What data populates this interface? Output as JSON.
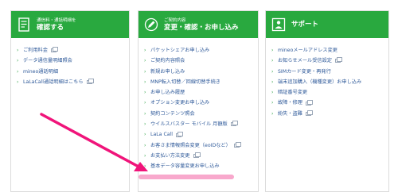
{
  "panels": [
    {
      "subtitle": "通信料・通話明細を",
      "title": "確認する",
      "icon": "bill-list-icon",
      "items": [
        {
          "label": "ご利用料金",
          "external": true
        },
        {
          "label": "データ通信量明細照会",
          "external": false
        },
        {
          "label": "mineo通話明細",
          "external": false
        },
        {
          "label": "LaLaCall通話明細はこちら",
          "external": true
        }
      ]
    },
    {
      "subtitle": "ご契約内容",
      "title": "変更・確認・お申し込み",
      "icon": "pencil-contract-icon",
      "items": [
        {
          "label": "パケットシェアお申し込み",
          "external": false
        },
        {
          "label": "ご契約内容照会",
          "external": false
        },
        {
          "label": "新規お申し込み",
          "external": false
        },
        {
          "label": "MNP転入切替／回線切替手続き",
          "external": false
        },
        {
          "label": "お申し込み履歴",
          "external": false
        },
        {
          "label": "オプション変更お申し込み",
          "external": false
        },
        {
          "label": "契約コンテンツ照会",
          "external": false
        },
        {
          "label": "ウイルスバスター モバイル 月額版",
          "external": true
        },
        {
          "label": "LaLa Call",
          "external": true
        },
        {
          "label": "お客さま情報照会変更（eoIDなど）",
          "external": true
        },
        {
          "label": "お支払い方法変更",
          "external": true
        },
        {
          "label": "基本データ容量変更お申し込み",
          "external": false
        }
      ]
    },
    {
      "subtitle": "",
      "title": "サポート",
      "icon": "support-desk-icon",
      "items": [
        {
          "label": "mineoメールアドレス変更",
          "external": false
        },
        {
          "label": "お知らせメール受信設定",
          "external": true
        },
        {
          "label": "SIMカード変更・再発行",
          "external": false
        },
        {
          "label": "端末追加購入（機種変更）お申し込み",
          "external": false
        },
        {
          "label": "暗証番号変更",
          "external": false
        },
        {
          "label": "故障・修理",
          "external": true
        },
        {
          "label": "紛失・盗難",
          "external": true
        }
      ]
    }
  ],
  "colors": {
    "header_green": "#29a93f",
    "link_blue": "#2f5a9a",
    "bullet_green": "#2aa040",
    "arrow_pink": "#f0147a",
    "highlight_pink": "#f8a8cc"
  }
}
